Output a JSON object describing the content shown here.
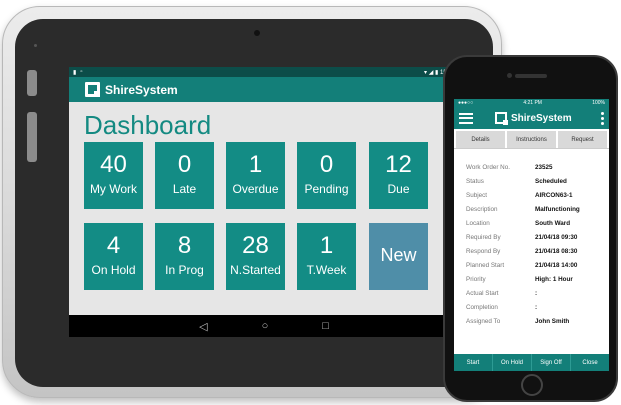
{
  "tablet": {
    "status_time": "15:16",
    "app_name": "ShireSystem",
    "page_title": "Dashboard",
    "tiles": [
      {
        "num": "40",
        "label": "My Work"
      },
      {
        "num": "0",
        "label": "Late"
      },
      {
        "num": "1",
        "label": "Overdue"
      },
      {
        "num": "0",
        "label": "Pending"
      },
      {
        "num": "12",
        "label": "Due"
      },
      {
        "num": "4",
        "label": "On Hold"
      },
      {
        "num": "8",
        "label": "In Prog"
      },
      {
        "num": "28",
        "label": "N.Started"
      },
      {
        "num": "1",
        "label": "T.Week"
      }
    ],
    "new_tile_label": "New",
    "nav": {
      "back": "◁",
      "home": "○",
      "recent": "□"
    }
  },
  "phone": {
    "status_time": "4:21 PM",
    "battery": "100%",
    "app_name": "ShireSystem",
    "tabs": [
      "Details",
      "Instructions",
      "Request"
    ],
    "fields": [
      {
        "key": "Work Order No.",
        "value": "23525"
      },
      {
        "key": "Status",
        "value": "Scheduled"
      },
      {
        "key": "Subject",
        "value": "AIRCON63-1"
      },
      {
        "key": "Description",
        "value": "Malfunctioning"
      },
      {
        "key": "Location",
        "value": "South Ward"
      },
      {
        "key": "Required By",
        "value": "21/04/18 09:30"
      },
      {
        "key": "Respond By",
        "value": "21/04/18 08:30"
      },
      {
        "key": "Planned Start",
        "value": "21/04/18 14:00"
      },
      {
        "key": "Priority",
        "value": "High: 1 Hour"
      },
      {
        "key": "Actual Start",
        "value": ":"
      },
      {
        "key": "Completion",
        "value": ":"
      },
      {
        "key": "Assigned To",
        "value": "John Smith"
      }
    ],
    "actions": [
      "Start",
      "On Hold",
      "Sign Off",
      "Close"
    ]
  },
  "colors": {
    "teal": "#138c85",
    "teal_dark": "#137f79",
    "new_tile": "#4f8ea8",
    "title_teal": "#148a82"
  }
}
